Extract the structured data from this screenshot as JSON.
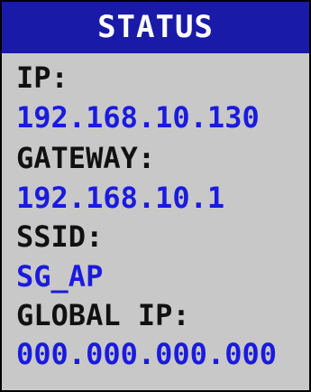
{
  "panel": {
    "title": "STATUS",
    "fields": [
      {
        "label": "IP:",
        "value": "192.168.10.130"
      },
      {
        "label": "GATEWAY:",
        "value": "192.168.10.1"
      },
      {
        "label": "SSID:",
        "value": "SG_AP"
      },
      {
        "label": "GLOBAL IP:",
        "value": "000.000.000.000"
      }
    ]
  },
  "colors": {
    "header_background": "#1a1aa8",
    "panel_background": "#c8c8c8",
    "label_text": "#111111",
    "value_text": "#1a1ae0"
  }
}
